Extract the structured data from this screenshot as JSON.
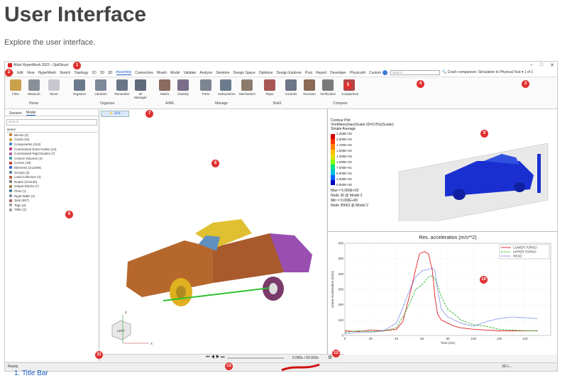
{
  "page": {
    "title": "User Interface",
    "subtitle": "Explore the user interface.",
    "list_item": "1.  Title Bar"
  },
  "app": {
    "title": "Altair HyperMesh  2023 - OptiStruct",
    "menus": [
      "File",
      "Edit",
      "View",
      "HyperMesh",
      "Sketch",
      "Topology",
      "1D",
      "2D",
      "3D",
      "Assembly",
      "Connectors",
      "Morph",
      "Model",
      "Validate",
      "Analyze",
      "Skeleton",
      "Design Space",
      "Optimize",
      "Design Explorer",
      "Post",
      "Report",
      "Developer",
      "PhysicsAI",
      "Custom"
    ],
    "active_menu": "Assembly",
    "search_placeholder": "Search",
    "session_label": "Crash comparison: Simulation to Physical Test",
    "page_indicator": "1 of 1"
  },
  "ribbon": {
    "tools": [
      {
        "label": "Files",
        "color": "#c9a24b"
      },
      {
        "label": "Measure",
        "color": "#8a8f9a"
      },
      {
        "label": "Move",
        "color": "#c8c8d0"
      },
      {
        "label": "Organize",
        "color": "#6a7a8c"
      },
      {
        "label": "Libraries",
        "color": "#7d8a99"
      },
      {
        "label": "Renumber",
        "color": "#6b7788"
      },
      {
        "label": "ID Manager",
        "color": "#5f6b7b"
      },
      {
        "label": "Match",
        "color": "#8b6a60"
      },
      {
        "label": "Classify",
        "color": "#7a6e8a"
      },
      {
        "label": "Parts",
        "color": "#7d8590"
      },
      {
        "label": "Subsystems",
        "color": "#6b7b8c"
      },
      {
        "label": "Mechanism",
        "color": "#8c7c6c"
      },
      {
        "label": "Reps",
        "color": "#aa5555"
      },
      {
        "label": "Controls",
        "color": "#6b7788"
      },
      {
        "label": "Scenario",
        "color": "#8a6a55"
      },
      {
        "label": "Verification",
        "color": "#7a7a7a"
      },
      {
        "label": "Comparison",
        "color": "#b04848"
      }
    ],
    "groups": [
      "Home",
      "Organize",
      "AI/ML",
      "Manage",
      "Build",
      "Compare"
    ]
  },
  "browser": {
    "tabs": [
      "Session",
      "Model"
    ],
    "active_tab": "Model",
    "search_placeholder": "Search",
    "column_header": "Name",
    "items": [
      {
        "label": "Blocks  (2)",
        "color": "#c08040"
      },
      {
        "label": "Cards  (16)",
        "color": "#d0a040"
      },
      {
        "label": "Components  (313)",
        "color": "#5080c0"
      },
      {
        "label": "Constrained Extra Nodes  (44)",
        "color": "#b04080"
      },
      {
        "label": "Constrained Rigid Bodies  (7)",
        "color": "#a060a0"
      },
      {
        "label": "Control Volumes  (4)",
        "color": "#40a0a0"
      },
      {
        "label": "Curves  (19)",
        "color": "#c04040"
      },
      {
        "label": "Elements  (212496)",
        "color": "#4060c0"
      },
      {
        "label": "Groups  (2)",
        "color": "#6080a0"
      },
      {
        "label": "Load Collection  (2)",
        "color": "#c06040"
      },
      {
        "label": "Nodes  (212136)",
        "color": "#808080"
      },
      {
        "label": "Output Blocks  (7)",
        "color": "#a08040"
      },
      {
        "label": "Plots  (1)",
        "color": "#4080a0"
      },
      {
        "label": "Rigid Walls  (1)",
        "color": "#8090a0"
      },
      {
        "label": "Sets  (557)",
        "color": "#a06060"
      },
      {
        "label": "Tags  (3)",
        "color": "#a0a0a0"
      },
      {
        "label": "Titles  (1)",
        "color": "#a0a0a0"
      }
    ]
  },
  "viewport": {
    "filter_label": "All",
    "axis_z": "Z",
    "axis_x": "X",
    "cube_face": "LEFT"
  },
  "contour": {
    "title_lines": [
      "Contour Plot",
      "VonMises(max)Scalar (D=0.0%)(Scalar)",
      "Simple Average"
    ],
    "values": [
      "2.250E+02",
      "2.000E+02",
      "1.750E+02",
      "1.500E+02",
      "1.250E+02",
      "1.000E+02",
      "7.500E+01",
      "5.000E+01",
      "2.500E+01",
      "0.000E+00"
    ],
    "colors": [
      "#d00000",
      "#ff3000",
      "#ff8000",
      "#ffc000",
      "#e0e000",
      "#80ff00",
      "#00e080",
      "#00c0e0",
      "#0060ff",
      "#0000c0"
    ],
    "stats": [
      "Max = 5.050E+02",
      "Node 30 @ Model 2",
      "Min = 0.000E+00",
      "Node 35663 @ Model 2"
    ]
  },
  "animation": {
    "time": "0.080s / 60.000s"
  },
  "status": {
    "text": "Ready",
    "right": "3D-L..."
  },
  "chart_data": {
    "type": "line",
    "title": "Res. acceleration (m/s**2)",
    "xlabel": "Time (ms)",
    "ylabel": "Linear Acceleration (m/s2)",
    "xlim": [
      0,
      160
    ],
    "ylim": [
      0,
      600
    ],
    "xticks": [
      0,
      20,
      40,
      60,
      80,
      100,
      120,
      140
    ],
    "yticks": [
      0,
      100,
      200,
      300,
      400,
      500,
      600
    ],
    "grid": true,
    "legend_position": "top-right",
    "series": [
      {
        "name": "LOWER TORSO",
        "color": "#e02020",
        "style": "solid",
        "x": [
          0,
          10,
          20,
          30,
          40,
          45,
          50,
          55,
          58,
          60,
          62,
          65,
          68,
          70,
          72,
          75,
          80,
          85,
          90,
          100,
          110,
          120,
          140,
          150
        ],
        "y": [
          30,
          25,
          35,
          30,
          40,
          90,
          250,
          430,
          530,
          540,
          545,
          530,
          420,
          250,
          140,
          100,
          80,
          60,
          50,
          40,
          35,
          30,
          30,
          30
        ]
      },
      {
        "name": "UPPER TORSO",
        "color": "#30b030",
        "style": "dashed",
        "x": [
          0,
          10,
          20,
          30,
          40,
          45,
          50,
          55,
          60,
          65,
          68,
          70,
          72,
          75,
          80,
          85,
          90,
          100,
          110,
          120,
          140,
          150
        ],
        "y": [
          20,
          30,
          25,
          30,
          50,
          120,
          200,
          300,
          330,
          380,
          390,
          370,
          330,
          250,
          170,
          140,
          100,
          70,
          60,
          40,
          30,
          30
        ]
      },
      {
        "name": "HEAD",
        "color": "#2040d0",
        "style": "dotted",
        "x": [
          0,
          10,
          20,
          30,
          40,
          45,
          50,
          55,
          60,
          65,
          68,
          70,
          72,
          75,
          80,
          85,
          90,
          95,
          100,
          110,
          120,
          130,
          140,
          150
        ],
        "y": [
          10,
          20,
          20,
          30,
          80,
          180,
          290,
          380,
          420,
          430,
          440,
          420,
          300,
          170,
          120,
          100,
          80,
          70,
          60,
          90,
          110,
          120,
          115,
          110
        ]
      }
    ]
  }
}
